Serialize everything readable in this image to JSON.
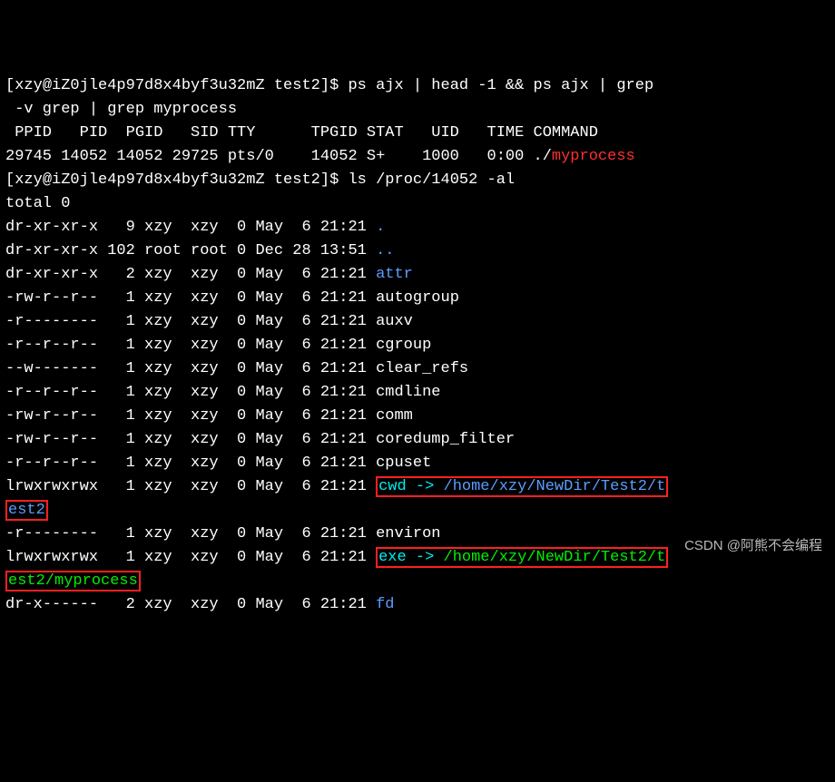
{
  "prompt": {
    "bracket_open": "[",
    "user": "xzy",
    "at": "@",
    "host": "iZ0jle4p97d8x4byf3u32mZ",
    "folder": " test2",
    "bracket_end": "]$ "
  },
  "cmd1": {
    "part1": "ps ajx | head -1 && ps ajx | grep",
    "part2": " -v grep | grep myprocess"
  },
  "ps_out": {
    "header": " PPID   PID  PGID   SID TTY      TPGID STAT   UID   TIME COMMAND",
    "row_prefix": "29745 14052 14052 29725 pts/0    14052 S+    1000   0:00 ./",
    "row_proc": "myprocess"
  },
  "cmd2": "ls /proc/14052 -al",
  "total_line": "total 0",
  "entries": [
    {
      "perm": "dr-xr-xr-x",
      "n": "  9",
      "u": "xzy ",
      "g": "xzy ",
      "s": " 0",
      "mo": "May",
      "d": "  6",
      "t": "21:21",
      "name": ".",
      "cls": "blue"
    },
    {
      "perm": "dr-xr-xr-x",
      "n": "102",
      "u": "root",
      "g": "root",
      "s": " 0",
      "mo": "Dec",
      "d": " 28",
      "t": "13:51",
      "name": "..",
      "cls": "blue"
    },
    {
      "perm": "dr-xr-xr-x",
      "n": "  2",
      "u": "xzy ",
      "g": "xzy ",
      "s": " 0",
      "mo": "May",
      "d": "  6",
      "t": "21:21",
      "name": "attr",
      "cls": "blue"
    },
    {
      "perm": "-rw-r--r--",
      "n": "  1",
      "u": "xzy ",
      "g": "xzy ",
      "s": " 0",
      "mo": "May",
      "d": "  6",
      "t": "21:21",
      "name": "autogroup",
      "cls": ""
    },
    {
      "perm": "-r--------",
      "n": "  1",
      "u": "xzy ",
      "g": "xzy ",
      "s": " 0",
      "mo": "May",
      "d": "  6",
      "t": "21:21",
      "name": "auxv",
      "cls": ""
    },
    {
      "perm": "-r--r--r--",
      "n": "  1",
      "u": "xzy ",
      "g": "xzy ",
      "s": " 0",
      "mo": "May",
      "d": "  6",
      "t": "21:21",
      "name": "cgroup",
      "cls": ""
    },
    {
      "perm": "--w-------",
      "n": "  1",
      "u": "xzy ",
      "g": "xzy ",
      "s": " 0",
      "mo": "May",
      "d": "  6",
      "t": "21:21",
      "name": "clear_refs",
      "cls": ""
    },
    {
      "perm": "-r--r--r--",
      "n": "  1",
      "u": "xzy ",
      "g": "xzy ",
      "s": " 0",
      "mo": "May",
      "d": "  6",
      "t": "21:21",
      "name": "cmdline",
      "cls": ""
    },
    {
      "perm": "-rw-r--r--",
      "n": "  1",
      "u": "xzy ",
      "g": "xzy ",
      "s": " 0",
      "mo": "May",
      "d": "  6",
      "t": "21:21",
      "name": "comm",
      "cls": ""
    },
    {
      "perm": "-rw-r--r--",
      "n": "  1",
      "u": "xzy ",
      "g": "xzy ",
      "s": " 0",
      "mo": "May",
      "d": "  6",
      "t": "21:21",
      "name": "coredump_filter",
      "cls": ""
    },
    {
      "perm": "-r--r--r--",
      "n": "  1",
      "u": "xzy ",
      "g": "xzy ",
      "s": " 0",
      "mo": "May",
      "d": "  6",
      "t": "21:21",
      "name": "cpuset",
      "cls": ""
    }
  ],
  "cwd_row": {
    "perm": "lrwxrwxrwx",
    "n": "  1",
    "u": "xzy ",
    "g": "xzy ",
    "s": " 0",
    "mo": "May",
    "d": "  6",
    "t": "21:21",
    "label": "cwd",
    "arrow": " -> ",
    "target_seg1": "/home/xzy/NewDir/Test2/t",
    "target_seg2": "est2"
  },
  "environ_row": {
    "perm": "-r--------",
    "n": "  1",
    "u": "xzy ",
    "g": "xzy ",
    "s": " 0",
    "mo": "May",
    "d": "  6",
    "t": "21:21",
    "name": "environ"
  },
  "exe_row": {
    "perm": "lrwxrwxrwx",
    "n": "  1",
    "u": "xzy ",
    "g": "xzy ",
    "s": " 0",
    "mo": "May",
    "d": "  6",
    "t": "21:21",
    "label": "exe",
    "arrow": " -> ",
    "target_seg1": "/home/xzy/NewDir/Test2/t",
    "target_seg2": "est2/myprocess"
  },
  "fd_row": {
    "perm": "dr-x------",
    "n": "  2",
    "u": "xzy ",
    "g": "xzy ",
    "s": " 0",
    "mo": "May",
    "d": "  6",
    "t": "21:21",
    "name": "fd",
    "cls": "blue"
  },
  "watermark": "CSDN @阿熊不会编程"
}
